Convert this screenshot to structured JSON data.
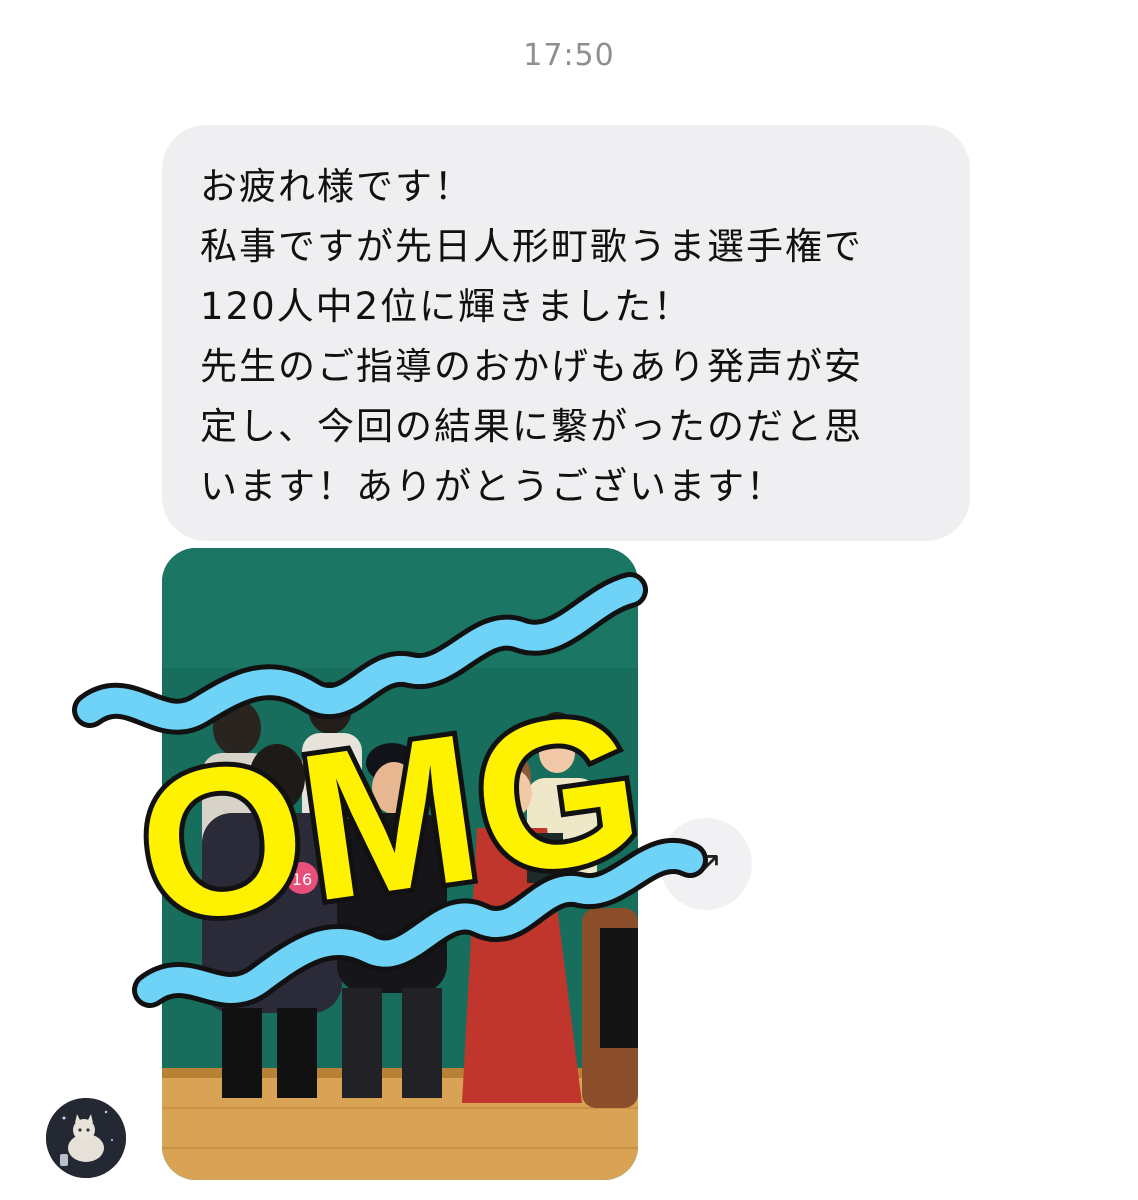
{
  "chat": {
    "timestamp": "17:50",
    "message": {
      "lines": [
        "お疲れ様です！",
        "私事ですが先日人形町歌うま選手権で",
        "120人中2位に輝きました！",
        "先生のご指導のおかげもあり発声が安",
        "定し、今回の結果に繋がったのだと思",
        "います！ありがとうございます！"
      ]
    },
    "photo": {
      "bib_number": "16"
    },
    "sticker": {
      "text": "OMG",
      "fill_color": "#fff200",
      "wave_color": "#6fd3f7"
    },
    "reaction": {
      "icon": "reaction-icon"
    },
    "sender": {
      "avatar_icon": "cat-avatar-icon"
    }
  }
}
